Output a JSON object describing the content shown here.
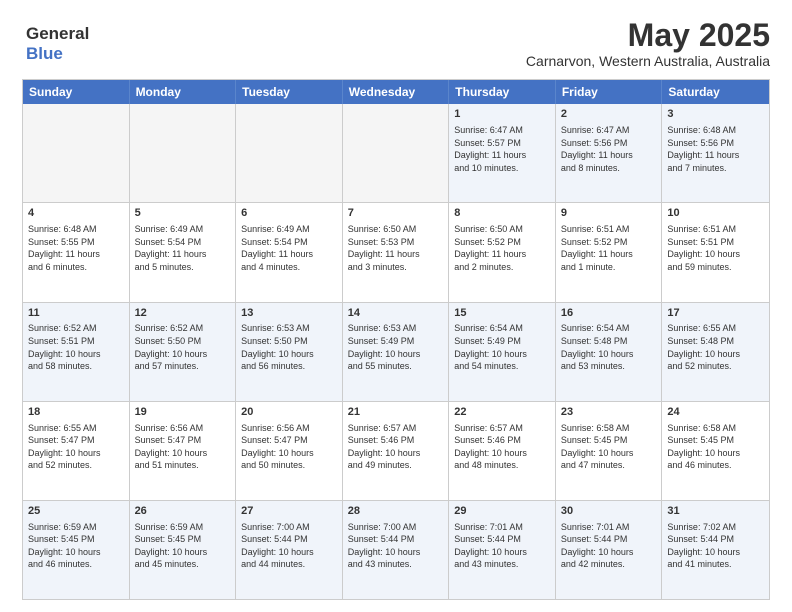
{
  "header": {
    "logo_line1": "General",
    "logo_line2": "Blue",
    "month_title": "May 2025",
    "location": "Carnarvon, Western Australia, Australia"
  },
  "weekdays": [
    "Sunday",
    "Monday",
    "Tuesday",
    "Wednesday",
    "Thursday",
    "Friday",
    "Saturday"
  ],
  "rows": [
    [
      {
        "day": "",
        "lines": [],
        "empty": true
      },
      {
        "day": "",
        "lines": [],
        "empty": true
      },
      {
        "day": "",
        "lines": [],
        "empty": true
      },
      {
        "day": "",
        "lines": [],
        "empty": true
      },
      {
        "day": "1",
        "lines": [
          "Sunrise: 6:47 AM",
          "Sunset: 5:57 PM",
          "Daylight: 11 hours",
          "and 10 minutes."
        ]
      },
      {
        "day": "2",
        "lines": [
          "Sunrise: 6:47 AM",
          "Sunset: 5:56 PM",
          "Daylight: 11 hours",
          "and 8 minutes."
        ]
      },
      {
        "day": "3",
        "lines": [
          "Sunrise: 6:48 AM",
          "Sunset: 5:56 PM",
          "Daylight: 11 hours",
          "and 7 minutes."
        ]
      }
    ],
    [
      {
        "day": "4",
        "lines": [
          "Sunrise: 6:48 AM",
          "Sunset: 5:55 PM",
          "Daylight: 11 hours",
          "and 6 minutes."
        ]
      },
      {
        "day": "5",
        "lines": [
          "Sunrise: 6:49 AM",
          "Sunset: 5:54 PM",
          "Daylight: 11 hours",
          "and 5 minutes."
        ]
      },
      {
        "day": "6",
        "lines": [
          "Sunrise: 6:49 AM",
          "Sunset: 5:54 PM",
          "Daylight: 11 hours",
          "and 4 minutes."
        ]
      },
      {
        "day": "7",
        "lines": [
          "Sunrise: 6:50 AM",
          "Sunset: 5:53 PM",
          "Daylight: 11 hours",
          "and 3 minutes."
        ]
      },
      {
        "day": "8",
        "lines": [
          "Sunrise: 6:50 AM",
          "Sunset: 5:52 PM",
          "Daylight: 11 hours",
          "and 2 minutes."
        ]
      },
      {
        "day": "9",
        "lines": [
          "Sunrise: 6:51 AM",
          "Sunset: 5:52 PM",
          "Daylight: 11 hours",
          "and 1 minute."
        ]
      },
      {
        "day": "10",
        "lines": [
          "Sunrise: 6:51 AM",
          "Sunset: 5:51 PM",
          "Daylight: 10 hours",
          "and 59 minutes."
        ]
      }
    ],
    [
      {
        "day": "11",
        "lines": [
          "Sunrise: 6:52 AM",
          "Sunset: 5:51 PM",
          "Daylight: 10 hours",
          "and 58 minutes."
        ]
      },
      {
        "day": "12",
        "lines": [
          "Sunrise: 6:52 AM",
          "Sunset: 5:50 PM",
          "Daylight: 10 hours",
          "and 57 minutes."
        ]
      },
      {
        "day": "13",
        "lines": [
          "Sunrise: 6:53 AM",
          "Sunset: 5:50 PM",
          "Daylight: 10 hours",
          "and 56 minutes."
        ]
      },
      {
        "day": "14",
        "lines": [
          "Sunrise: 6:53 AM",
          "Sunset: 5:49 PM",
          "Daylight: 10 hours",
          "and 55 minutes."
        ]
      },
      {
        "day": "15",
        "lines": [
          "Sunrise: 6:54 AM",
          "Sunset: 5:49 PM",
          "Daylight: 10 hours",
          "and 54 minutes."
        ]
      },
      {
        "day": "16",
        "lines": [
          "Sunrise: 6:54 AM",
          "Sunset: 5:48 PM",
          "Daylight: 10 hours",
          "and 53 minutes."
        ]
      },
      {
        "day": "17",
        "lines": [
          "Sunrise: 6:55 AM",
          "Sunset: 5:48 PM",
          "Daylight: 10 hours",
          "and 52 minutes."
        ]
      }
    ],
    [
      {
        "day": "18",
        "lines": [
          "Sunrise: 6:55 AM",
          "Sunset: 5:47 PM",
          "Daylight: 10 hours",
          "and 52 minutes."
        ]
      },
      {
        "day": "19",
        "lines": [
          "Sunrise: 6:56 AM",
          "Sunset: 5:47 PM",
          "Daylight: 10 hours",
          "and 51 minutes."
        ]
      },
      {
        "day": "20",
        "lines": [
          "Sunrise: 6:56 AM",
          "Sunset: 5:47 PM",
          "Daylight: 10 hours",
          "and 50 minutes."
        ]
      },
      {
        "day": "21",
        "lines": [
          "Sunrise: 6:57 AM",
          "Sunset: 5:46 PM",
          "Daylight: 10 hours",
          "and 49 minutes."
        ]
      },
      {
        "day": "22",
        "lines": [
          "Sunrise: 6:57 AM",
          "Sunset: 5:46 PM",
          "Daylight: 10 hours",
          "and 48 minutes."
        ]
      },
      {
        "day": "23",
        "lines": [
          "Sunrise: 6:58 AM",
          "Sunset: 5:45 PM",
          "Daylight: 10 hours",
          "and 47 minutes."
        ]
      },
      {
        "day": "24",
        "lines": [
          "Sunrise: 6:58 AM",
          "Sunset: 5:45 PM",
          "Daylight: 10 hours",
          "and 46 minutes."
        ]
      }
    ],
    [
      {
        "day": "25",
        "lines": [
          "Sunrise: 6:59 AM",
          "Sunset: 5:45 PM",
          "Daylight: 10 hours",
          "and 46 minutes."
        ]
      },
      {
        "day": "26",
        "lines": [
          "Sunrise: 6:59 AM",
          "Sunset: 5:45 PM",
          "Daylight: 10 hours",
          "and 45 minutes."
        ]
      },
      {
        "day": "27",
        "lines": [
          "Sunrise: 7:00 AM",
          "Sunset: 5:44 PM",
          "Daylight: 10 hours",
          "and 44 minutes."
        ]
      },
      {
        "day": "28",
        "lines": [
          "Sunrise: 7:00 AM",
          "Sunset: 5:44 PM",
          "Daylight: 10 hours",
          "and 43 minutes."
        ]
      },
      {
        "day": "29",
        "lines": [
          "Sunrise: 7:01 AM",
          "Sunset: 5:44 PM",
          "Daylight: 10 hours",
          "and 43 minutes."
        ]
      },
      {
        "day": "30",
        "lines": [
          "Sunrise: 7:01 AM",
          "Sunset: 5:44 PM",
          "Daylight: 10 hours",
          "and 42 minutes."
        ]
      },
      {
        "day": "31",
        "lines": [
          "Sunrise: 7:02 AM",
          "Sunset: 5:44 PM",
          "Daylight: 10 hours",
          "and 41 minutes."
        ]
      }
    ]
  ],
  "alt_rows": [
    0,
    2,
    4
  ]
}
